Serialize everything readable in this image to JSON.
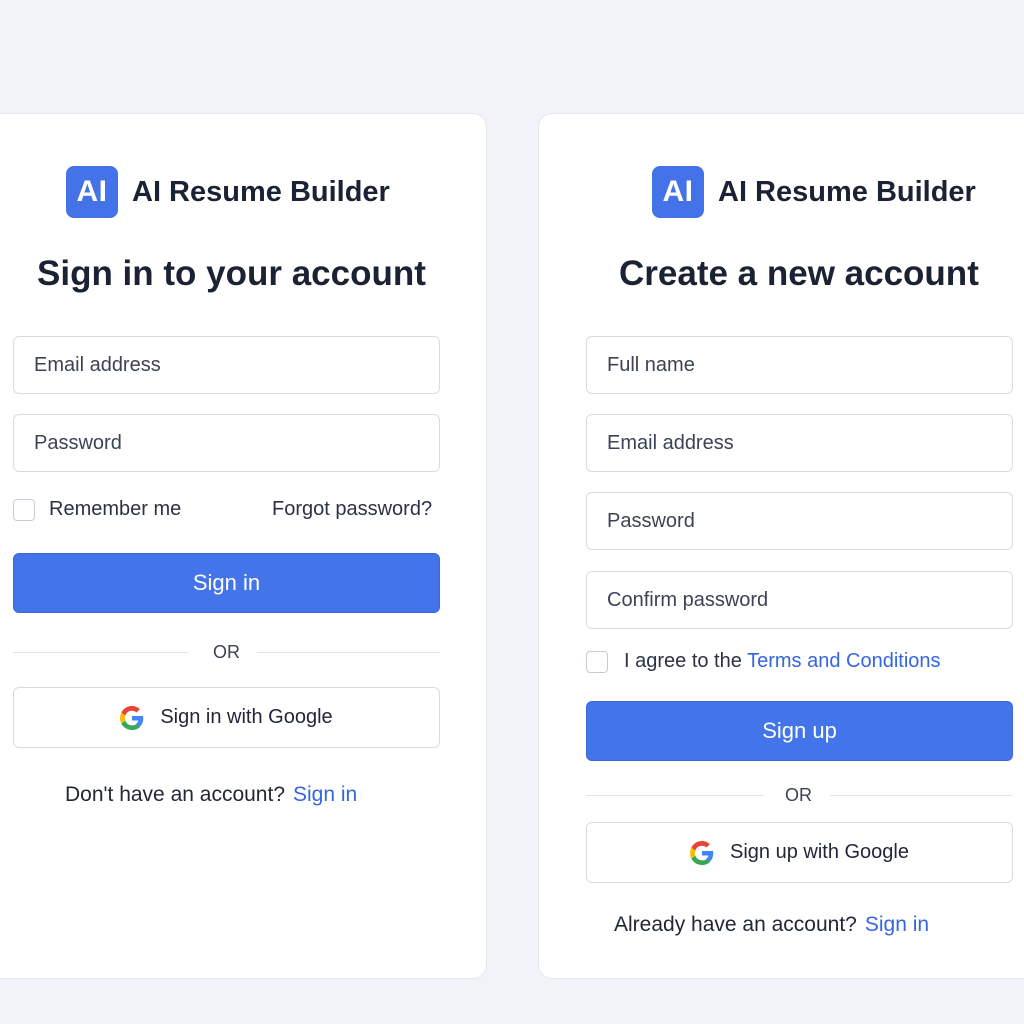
{
  "brand": {
    "logo_text": "AI",
    "name": "AI Resume Builder"
  },
  "signin": {
    "heading": "Sign in to your account",
    "email_placeholder": "Email address",
    "password_placeholder": "Password",
    "remember_label": "Remember me",
    "forgot_link": "Forgot password?",
    "submit_label": "Sign in",
    "or_label": "OR",
    "google_label": "Sign in with Google",
    "footer_prompt": "Don't have an account?",
    "footer_link": "Sign in"
  },
  "signup": {
    "heading": "Create a new account",
    "fullname_placeholder": "Full name",
    "email_placeholder": "Email address",
    "password_placeholder": "Password",
    "confirm_placeholder": "Confirm password",
    "agree_prefix": "I agree to the",
    "terms_link": "Terms and Conditions",
    "submit_label": "Sign up",
    "or_label": "OR",
    "google_label": "Sign up with Google",
    "footer_prompt": "Already have an account?",
    "footer_link": "Sign in"
  },
  "colors": {
    "accent": "#4474ea",
    "link": "#3366e0",
    "background": "#f1f3f8"
  }
}
